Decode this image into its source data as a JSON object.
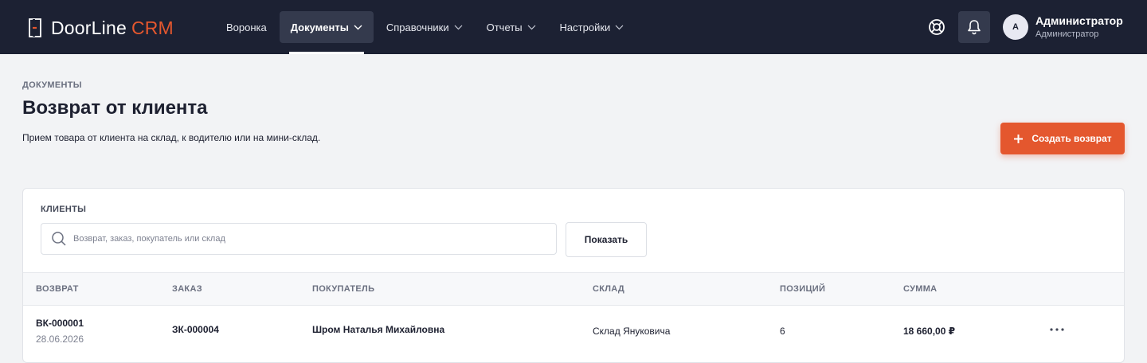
{
  "brand": {
    "name": "DoorLine",
    "accent": "CRM",
    "accent_color": "#e4572e"
  },
  "nav": {
    "items": [
      {
        "label": "Воронка",
        "dropdown": false
      },
      {
        "label": "Документы",
        "dropdown": true,
        "active": true
      },
      {
        "label": "Справочники",
        "dropdown": true
      },
      {
        "label": "Отчеты",
        "dropdown": true
      },
      {
        "label": "Настройки",
        "dropdown": true
      }
    ]
  },
  "header_icons": {
    "help": "lifebuoy-icon",
    "notifications": "bell-icon"
  },
  "user": {
    "initial": "А",
    "name": "Администратор",
    "role": "Администратор"
  },
  "page": {
    "breadcrumb": "ДОКУМЕНТЫ",
    "title": "Возврат от клиента",
    "description": "Прием товара от клиента на склад, к водителю или на мини-склад.",
    "create_button": "Создать возврат"
  },
  "filter": {
    "label": "КЛИЕНТЫ",
    "search_placeholder": "Возврат, заказ, покупатель или склад",
    "search_value": "",
    "show_button": "Показать"
  },
  "table": {
    "columns": [
      "ВОЗВРАТ",
      "ЗАКАЗ",
      "ПОКУПАТЕЛЬ",
      "СКЛАД",
      "ПОЗИЦИЙ",
      "СУММА"
    ],
    "rows": [
      {
        "return_no": "ВК-000001",
        "date": "28.06.2026",
        "order": "ЗК-000004",
        "customer": "Шром Наталья Михайловна",
        "warehouse": "Склад Януковича",
        "positions": "6",
        "sum": "18 660,00 ₽"
      }
    ]
  },
  "colors": {
    "topbar": "#1c2133",
    "accent": "#e4572e",
    "background": "#f2f3f5"
  }
}
